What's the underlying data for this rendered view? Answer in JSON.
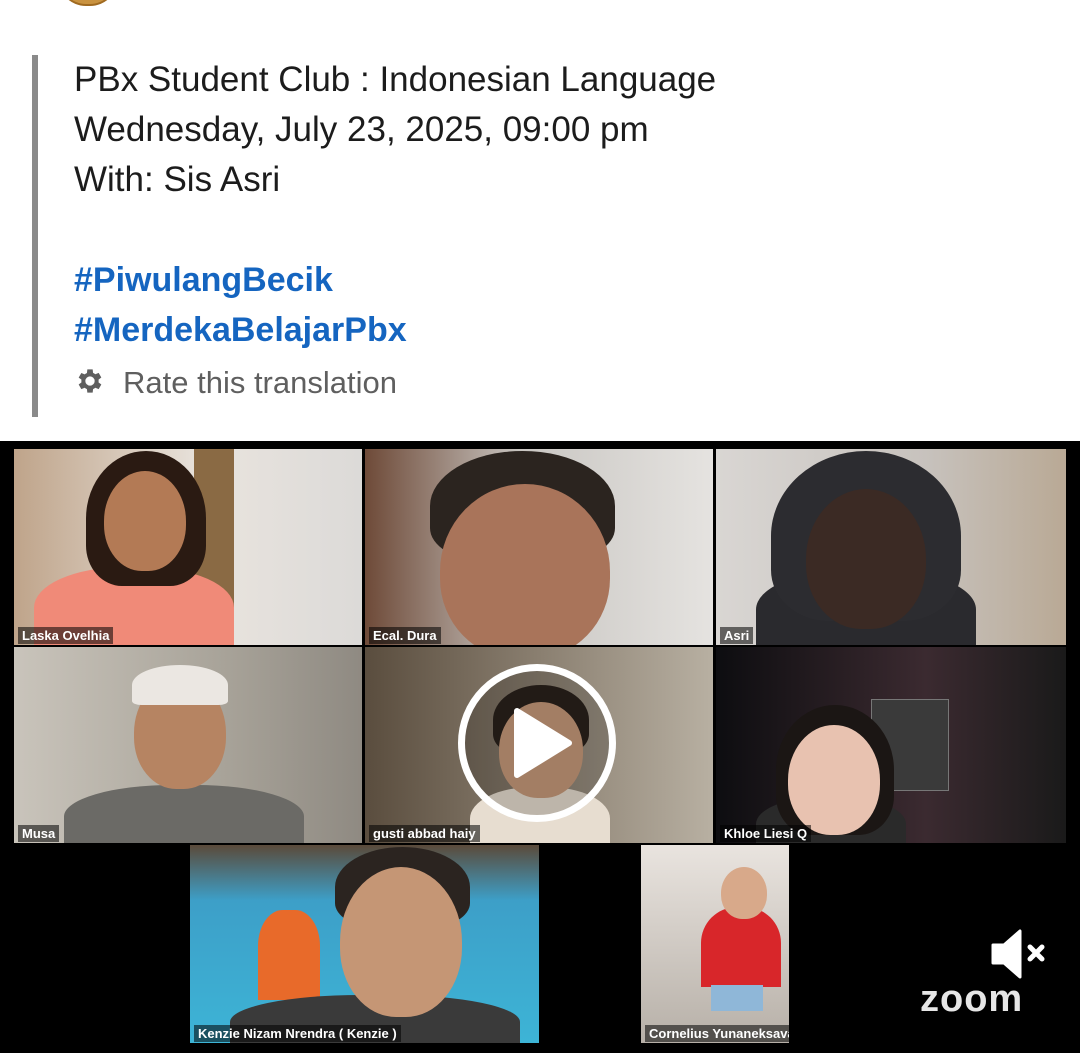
{
  "post": {
    "lines": [
      "PBx Student Club : Indonesian Language",
      "Wednesday, July 23, 2025, 09:00 pm",
      "With: Sis Asri"
    ],
    "hashtags": [
      "#PiwulangBecik",
      "#MerdekaBelajarPbx"
    ],
    "rate_translation_label": "Rate this translation",
    "rate_icon": "gear-icon"
  },
  "video": {
    "participants": [
      "Laska Ovelhia",
      "Ecal. Dura",
      "Asri",
      "Musa",
      "gusti abbad haiy",
      "Khloe Liesi Q",
      "Kenzie Nizam Nrendra ( Kenzie )",
      "Cornelius Yunaneksavano (Vano)"
    ],
    "brand": "zoom",
    "icons": {
      "play": "play-icon",
      "mute": "speaker-muted-icon"
    }
  }
}
